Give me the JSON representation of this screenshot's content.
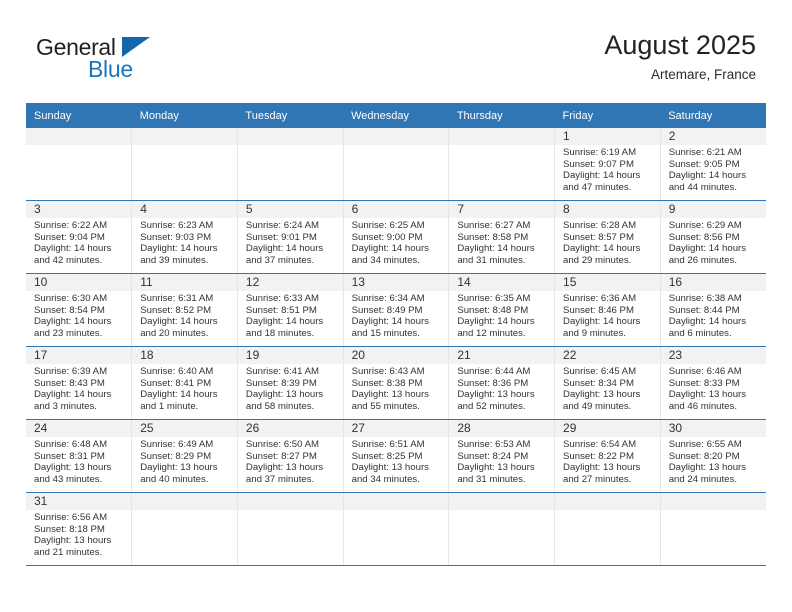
{
  "brand": {
    "name_top": "General",
    "name_bottom": "Blue",
    "triangle_icon": "blue-triangle-logo-mark",
    "color_top": "#231f20",
    "color_bottom": "#1b75bb"
  },
  "header": {
    "title": "August 2025",
    "subtitle": "Artemare, France"
  },
  "theme": {
    "header_bg": "#3075b4",
    "header_text": "#ffffff",
    "daynum_band_bg": "#f2f2f2",
    "cell_bg": "#ffffff",
    "row_rule": "#3075b4",
    "col_rule": "#e6e6e6"
  },
  "weekdays": [
    "Sunday",
    "Monday",
    "Tuesday",
    "Wednesday",
    "Thursday",
    "Friday",
    "Saturday"
  ],
  "weeks": [
    [
      {
        "day": "",
        "lines": []
      },
      {
        "day": "",
        "lines": []
      },
      {
        "day": "",
        "lines": []
      },
      {
        "day": "",
        "lines": []
      },
      {
        "day": "",
        "lines": []
      },
      {
        "day": "1",
        "lines": [
          "Sunrise: 6:19 AM",
          "Sunset: 9:07 PM",
          "Daylight: 14 hours",
          "and 47 minutes."
        ]
      },
      {
        "day": "2",
        "lines": [
          "Sunrise: 6:21 AM",
          "Sunset: 9:05 PM",
          "Daylight: 14 hours",
          "and 44 minutes."
        ]
      }
    ],
    [
      {
        "day": "3",
        "lines": [
          "Sunrise: 6:22 AM",
          "Sunset: 9:04 PM",
          "Daylight: 14 hours",
          "and 42 minutes."
        ]
      },
      {
        "day": "4",
        "lines": [
          "Sunrise: 6:23 AM",
          "Sunset: 9:03 PM",
          "Daylight: 14 hours",
          "and 39 minutes."
        ]
      },
      {
        "day": "5",
        "lines": [
          "Sunrise: 6:24 AM",
          "Sunset: 9:01 PM",
          "Daylight: 14 hours",
          "and 37 minutes."
        ]
      },
      {
        "day": "6",
        "lines": [
          "Sunrise: 6:25 AM",
          "Sunset: 9:00 PM",
          "Daylight: 14 hours",
          "and 34 minutes."
        ]
      },
      {
        "day": "7",
        "lines": [
          "Sunrise: 6:27 AM",
          "Sunset: 8:58 PM",
          "Daylight: 14 hours",
          "and 31 minutes."
        ]
      },
      {
        "day": "8",
        "lines": [
          "Sunrise: 6:28 AM",
          "Sunset: 8:57 PM",
          "Daylight: 14 hours",
          "and 29 minutes."
        ]
      },
      {
        "day": "9",
        "lines": [
          "Sunrise: 6:29 AM",
          "Sunset: 8:56 PM",
          "Daylight: 14 hours",
          "and 26 minutes."
        ]
      }
    ],
    [
      {
        "day": "10",
        "lines": [
          "Sunrise: 6:30 AM",
          "Sunset: 8:54 PM",
          "Daylight: 14 hours",
          "and 23 minutes."
        ]
      },
      {
        "day": "11",
        "lines": [
          "Sunrise: 6:31 AM",
          "Sunset: 8:52 PM",
          "Daylight: 14 hours",
          "and 20 minutes."
        ]
      },
      {
        "day": "12",
        "lines": [
          "Sunrise: 6:33 AM",
          "Sunset: 8:51 PM",
          "Daylight: 14 hours",
          "and 18 minutes."
        ]
      },
      {
        "day": "13",
        "lines": [
          "Sunrise: 6:34 AM",
          "Sunset: 8:49 PM",
          "Daylight: 14 hours",
          "and 15 minutes."
        ]
      },
      {
        "day": "14",
        "lines": [
          "Sunrise: 6:35 AM",
          "Sunset: 8:48 PM",
          "Daylight: 14 hours",
          "and 12 minutes."
        ]
      },
      {
        "day": "15",
        "lines": [
          "Sunrise: 6:36 AM",
          "Sunset: 8:46 PM",
          "Daylight: 14 hours",
          "and 9 minutes."
        ]
      },
      {
        "day": "16",
        "lines": [
          "Sunrise: 6:38 AM",
          "Sunset: 8:44 PM",
          "Daylight: 14 hours",
          "and 6 minutes."
        ]
      }
    ],
    [
      {
        "day": "17",
        "lines": [
          "Sunrise: 6:39 AM",
          "Sunset: 8:43 PM",
          "Daylight: 14 hours",
          "and 3 minutes."
        ]
      },
      {
        "day": "18",
        "lines": [
          "Sunrise: 6:40 AM",
          "Sunset: 8:41 PM",
          "Daylight: 14 hours",
          "and 1 minute."
        ]
      },
      {
        "day": "19",
        "lines": [
          "Sunrise: 6:41 AM",
          "Sunset: 8:39 PM",
          "Daylight: 13 hours",
          "and 58 minutes."
        ]
      },
      {
        "day": "20",
        "lines": [
          "Sunrise: 6:43 AM",
          "Sunset: 8:38 PM",
          "Daylight: 13 hours",
          "and 55 minutes."
        ]
      },
      {
        "day": "21",
        "lines": [
          "Sunrise: 6:44 AM",
          "Sunset: 8:36 PM",
          "Daylight: 13 hours",
          "and 52 minutes."
        ]
      },
      {
        "day": "22",
        "lines": [
          "Sunrise: 6:45 AM",
          "Sunset: 8:34 PM",
          "Daylight: 13 hours",
          "and 49 minutes."
        ]
      },
      {
        "day": "23",
        "lines": [
          "Sunrise: 6:46 AM",
          "Sunset: 8:33 PM",
          "Daylight: 13 hours",
          "and 46 minutes."
        ]
      }
    ],
    [
      {
        "day": "24",
        "lines": [
          "Sunrise: 6:48 AM",
          "Sunset: 8:31 PM",
          "Daylight: 13 hours",
          "and 43 minutes."
        ]
      },
      {
        "day": "25",
        "lines": [
          "Sunrise: 6:49 AM",
          "Sunset: 8:29 PM",
          "Daylight: 13 hours",
          "and 40 minutes."
        ]
      },
      {
        "day": "26",
        "lines": [
          "Sunrise: 6:50 AM",
          "Sunset: 8:27 PM",
          "Daylight: 13 hours",
          "and 37 minutes."
        ]
      },
      {
        "day": "27",
        "lines": [
          "Sunrise: 6:51 AM",
          "Sunset: 8:25 PM",
          "Daylight: 13 hours",
          "and 34 minutes."
        ]
      },
      {
        "day": "28",
        "lines": [
          "Sunrise: 6:53 AM",
          "Sunset: 8:24 PM",
          "Daylight: 13 hours",
          "and 31 minutes."
        ]
      },
      {
        "day": "29",
        "lines": [
          "Sunrise: 6:54 AM",
          "Sunset: 8:22 PM",
          "Daylight: 13 hours",
          "and 27 minutes."
        ]
      },
      {
        "day": "30",
        "lines": [
          "Sunrise: 6:55 AM",
          "Sunset: 8:20 PM",
          "Daylight: 13 hours",
          "and 24 minutes."
        ]
      }
    ],
    [
      {
        "day": "31",
        "lines": [
          "Sunrise: 6:56 AM",
          "Sunset: 8:18 PM",
          "Daylight: 13 hours",
          "and 21 minutes."
        ]
      },
      {
        "day": "",
        "lines": []
      },
      {
        "day": "",
        "lines": []
      },
      {
        "day": "",
        "lines": []
      },
      {
        "day": "",
        "lines": []
      },
      {
        "day": "",
        "lines": []
      },
      {
        "day": "",
        "lines": []
      }
    ]
  ]
}
